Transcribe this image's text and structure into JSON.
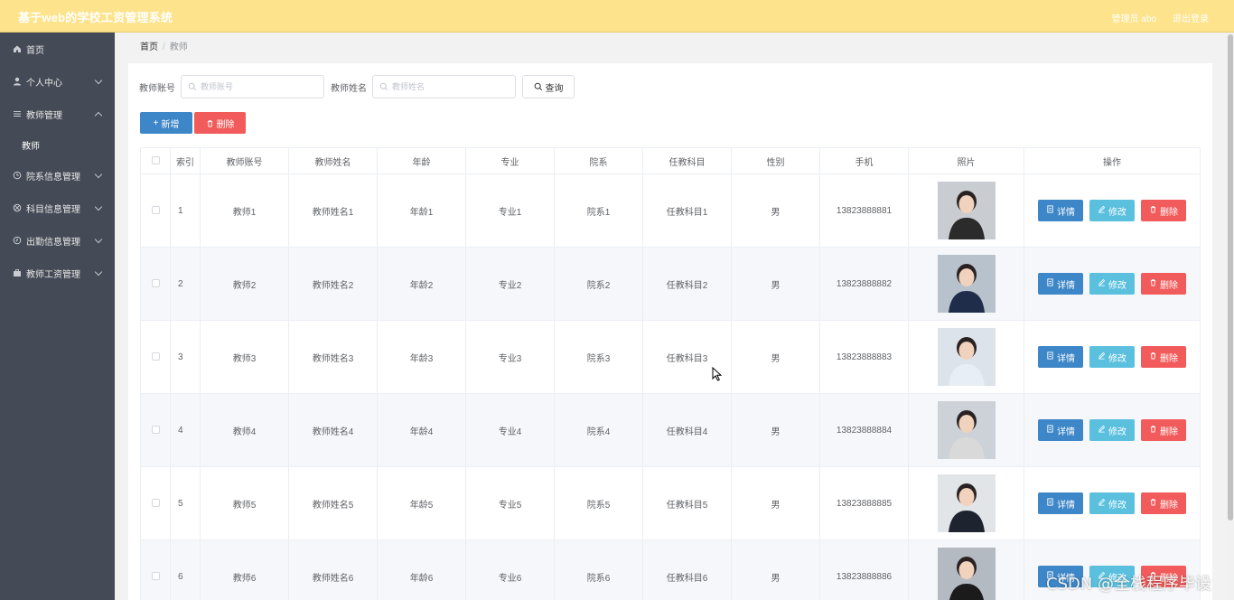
{
  "header": {
    "title": "基于web的学校工资管理系统",
    "user_label": "管理员 abo",
    "logout_label": "退出登录"
  },
  "sidebar": {
    "items": [
      {
        "label": "首页",
        "icon": "home-icon"
      },
      {
        "label": "个人中心",
        "icon": "user-icon"
      },
      {
        "label": "教师管理",
        "icon": "menu-icon",
        "expanded": true,
        "children": [
          {
            "label": "教师"
          }
        ]
      },
      {
        "label": "院系信息管理",
        "icon": "clock-icon"
      },
      {
        "label": "科目信息管理",
        "icon": "basketball-icon"
      },
      {
        "label": "出勤信息管理",
        "icon": "time-icon"
      },
      {
        "label": "教师工资管理",
        "icon": "briefcase-icon"
      }
    ]
  },
  "breadcrumb": {
    "home": "首页",
    "separator": "/",
    "current": "教师"
  },
  "search": {
    "account_label": "教师账号",
    "account_placeholder": "教师账号",
    "name_label": "教师姓名",
    "name_placeholder": "教师姓名",
    "query_label": "查询"
  },
  "actions": {
    "add_label": "新增",
    "delete_label": "删除"
  },
  "table": {
    "columns": [
      "索引",
      "教师账号",
      "教师姓名",
      "年龄",
      "专业",
      "院系",
      "任教科目",
      "性别",
      "手机",
      "照片",
      "操作"
    ],
    "row_actions": {
      "detail": "详情",
      "edit": "修改",
      "delete": "删除"
    },
    "rows": [
      {
        "index": "1",
        "account": "教师1",
        "name": "教师姓名1",
        "age": "年龄1",
        "major": "专业1",
        "dept": "院系1",
        "subject": "任教科目1",
        "gender": "男",
        "phone": "13823888881"
      },
      {
        "index": "2",
        "account": "教师2",
        "name": "教师姓名2",
        "age": "年龄2",
        "major": "专业2",
        "dept": "院系2",
        "subject": "任教科目2",
        "gender": "男",
        "phone": "13823888882"
      },
      {
        "index": "3",
        "account": "教师3",
        "name": "教师姓名3",
        "age": "年龄3",
        "major": "专业3",
        "dept": "院系3",
        "subject": "任教科目3",
        "gender": "男",
        "phone": "13823888883"
      },
      {
        "index": "4",
        "account": "教师4",
        "name": "教师姓名4",
        "age": "年龄4",
        "major": "专业4",
        "dept": "院系4",
        "subject": "任教科目4",
        "gender": "男",
        "phone": "13823888884"
      },
      {
        "index": "5",
        "account": "教师5",
        "name": "教师姓名5",
        "age": "年龄5",
        "major": "专业5",
        "dept": "院系5",
        "subject": "任教科目5",
        "gender": "男",
        "phone": "13823888885"
      },
      {
        "index": "6",
        "account": "教师6",
        "name": "教师姓名6",
        "age": "年龄6",
        "major": "专业6",
        "dept": "院系6",
        "subject": "任教科目6",
        "gender": "男",
        "phone": "13823888886"
      }
    ]
  },
  "watermark": "CSDN @全栈程序毕设",
  "colors": {
    "header_bg": "#fde38b",
    "sidebar_bg": "#454b56",
    "primary": "#3d86c7",
    "info": "#5bc0de",
    "danger": "#f25b5b"
  }
}
